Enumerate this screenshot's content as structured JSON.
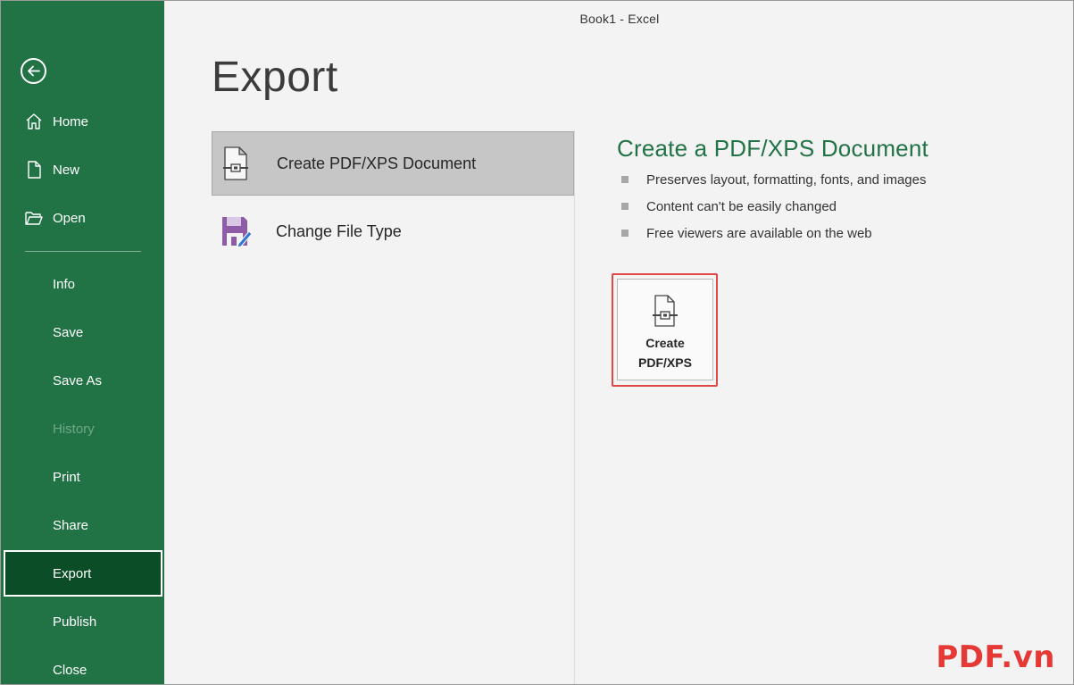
{
  "window": {
    "title": "Book1  -  Excel"
  },
  "sidebar": {
    "back_icon": "back-arrow-icon",
    "items": [
      {
        "label": "Home",
        "icon": "home-icon"
      },
      {
        "label": "New",
        "icon": "new-document-icon"
      },
      {
        "label": "Open",
        "icon": "open-folder-icon"
      },
      {
        "label": "Info"
      },
      {
        "label": "Save"
      },
      {
        "label": "Save As"
      },
      {
        "label": "History",
        "disabled": true
      },
      {
        "label": "Print"
      },
      {
        "label": "Share"
      },
      {
        "label": "Export",
        "active": true
      },
      {
        "label": "Publish"
      },
      {
        "label": "Close"
      }
    ]
  },
  "main": {
    "title": "Export",
    "options": [
      {
        "label": "Create PDF/XPS Document",
        "icon": "pdf-document-icon",
        "selected": true
      },
      {
        "label": "Change File Type",
        "icon": "change-file-type-icon",
        "selected": false
      }
    ]
  },
  "detail": {
    "title": "Create a PDF/XPS Document",
    "bullets": [
      "Preserves layout, formatting, fonts, and images",
      "Content can't be easily changed",
      "Free viewers are available on the web"
    ],
    "button": {
      "line1": "Create",
      "line2": "PDF/XPS",
      "icon": "pdf-document-icon"
    }
  },
  "watermark": "PDF.vn",
  "colors": {
    "sidebar": "#217346",
    "sidebar_active": "#0b4d27",
    "accent_title": "#217346",
    "highlight": "#e04848"
  }
}
